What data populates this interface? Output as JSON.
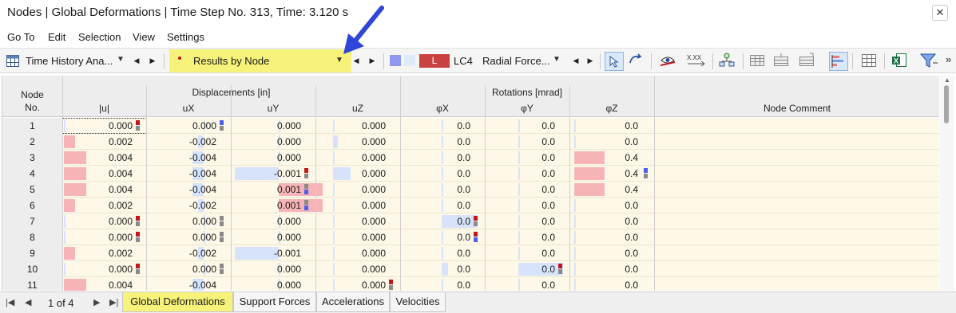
{
  "window": {
    "title": "Nodes | Global Deformations | Time Step No. 313, Time: 3.120 s",
    "close_glyph": "✕"
  },
  "menu": [
    "Go To",
    "Edit",
    "Selection",
    "View",
    "Settings"
  ],
  "toolbar": {
    "analysis_combo": "Time History Ana...",
    "results_combo": "Results by Node",
    "load_case_type": "L",
    "load_case": "LC4",
    "load_case_name": "Radial Force...",
    "more_glyph": "»"
  },
  "table": {
    "group_headers": {
      "displacements": "Displacements [in]",
      "rotations": "Rotations [mrad]"
    },
    "node_header": [
      "Node",
      "No."
    ],
    "columns": [
      "|u|",
      "uX",
      "uY",
      "uZ",
      "φX",
      "φY",
      "φZ",
      "Node Comment"
    ],
    "rows": [
      {
        "no": "1",
        "u": "0.000",
        "ux": "0.000",
        "uy": "0.000",
        "uz": "0.000",
        "px": "0.0",
        "py": "0.0",
        "pz": "0.0"
      },
      {
        "no": "2",
        "u": "0.002",
        "ux": "-0.002",
        "uy": "0.000",
        "uz": "0.000",
        "px": "0.0",
        "py": "0.0",
        "pz": "0.0"
      },
      {
        "no": "3",
        "u": "0.004",
        "ux": "-0.004",
        "uy": "0.000",
        "uz": "0.000",
        "px": "0.0",
        "py": "0.0",
        "pz": "0.4"
      },
      {
        "no": "4",
        "u": "0.004",
        "ux": "-0.004",
        "uy": "-0.001",
        "uz": "0.000",
        "px": "0.0",
        "py": "0.0",
        "pz": "0.4"
      },
      {
        "no": "5",
        "u": "0.004",
        "ux": "-0.004",
        "uy": "0.001",
        "uz": "0.000",
        "px": "0.0",
        "py": "0.0",
        "pz": "0.4"
      },
      {
        "no": "6",
        "u": "0.002",
        "ux": "-0.002",
        "uy": "0.001",
        "uz": "0.000",
        "px": "0.0",
        "py": "0.0",
        "pz": "0.0"
      },
      {
        "no": "7",
        "u": "0.000",
        "ux": "0.000",
        "uy": "0.000",
        "uz": "0.000",
        "px": "0.0",
        "py": "0.0",
        "pz": "0.0"
      },
      {
        "no": "8",
        "u": "0.000",
        "ux": "0.000",
        "uy": "0.000",
        "uz": "0.000",
        "px": "0.0",
        "py": "0.0",
        "pz": "0.0"
      },
      {
        "no": "9",
        "u": "0.002",
        "ux": "-0.002",
        "uy": "-0.001",
        "uz": "0.000",
        "px": "0.0",
        "py": "0.0",
        "pz": "0.0"
      },
      {
        "no": "10",
        "u": "0.000",
        "ux": "0.000",
        "uy": "0.000",
        "uz": "0.000",
        "px": "0.0",
        "py": "0.0",
        "pz": "0.0"
      },
      {
        "no": "11",
        "u": "0.004",
        "ux": "-0.004",
        "uy": "0.000",
        "uz": "0.000",
        "px": "0.0",
        "py": "0.0",
        "pz": "0.0"
      }
    ]
  },
  "pager": {
    "info": "1 of 4"
  },
  "tabs": [
    "Global Deformations",
    "Support Forces",
    "Accelerations",
    "Velocities"
  ],
  "colors": {
    "row_bg": "#fdf8e8",
    "pos_bar": "#f7b4b8",
    "neg_bar": "#d6e3fb",
    "highlight": "#f7f27a",
    "arrow": "#2f46d8",
    "marker_red": "#c0161b",
    "marker_blue": "#4a5ef0",
    "marker_gray": "#8a8a8a"
  }
}
